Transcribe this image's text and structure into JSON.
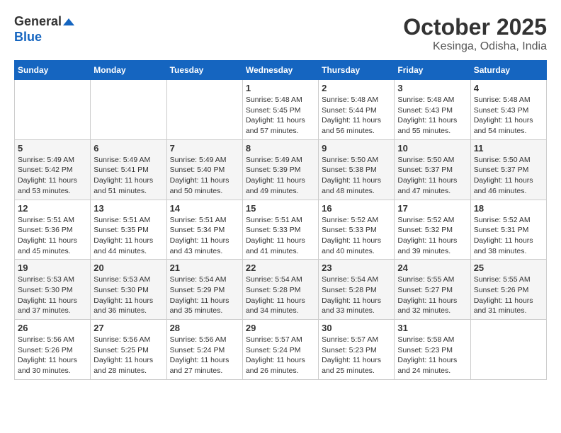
{
  "header": {
    "logo_line1": "General",
    "logo_line2": "Blue",
    "title": "October 2025",
    "subtitle": "Kesinga, Odisha, India"
  },
  "weekdays": [
    "Sunday",
    "Monday",
    "Tuesday",
    "Wednesday",
    "Thursday",
    "Friday",
    "Saturday"
  ],
  "weeks": [
    [
      {
        "day": "",
        "info": ""
      },
      {
        "day": "",
        "info": ""
      },
      {
        "day": "",
        "info": ""
      },
      {
        "day": "1",
        "info": "Sunrise: 5:48 AM\nSunset: 5:45 PM\nDaylight: 11 hours\nand 57 minutes."
      },
      {
        "day": "2",
        "info": "Sunrise: 5:48 AM\nSunset: 5:44 PM\nDaylight: 11 hours\nand 56 minutes."
      },
      {
        "day": "3",
        "info": "Sunrise: 5:48 AM\nSunset: 5:43 PM\nDaylight: 11 hours\nand 55 minutes."
      },
      {
        "day": "4",
        "info": "Sunrise: 5:48 AM\nSunset: 5:43 PM\nDaylight: 11 hours\nand 54 minutes."
      }
    ],
    [
      {
        "day": "5",
        "info": "Sunrise: 5:49 AM\nSunset: 5:42 PM\nDaylight: 11 hours\nand 53 minutes."
      },
      {
        "day": "6",
        "info": "Sunrise: 5:49 AM\nSunset: 5:41 PM\nDaylight: 11 hours\nand 51 minutes."
      },
      {
        "day": "7",
        "info": "Sunrise: 5:49 AM\nSunset: 5:40 PM\nDaylight: 11 hours\nand 50 minutes."
      },
      {
        "day": "8",
        "info": "Sunrise: 5:49 AM\nSunset: 5:39 PM\nDaylight: 11 hours\nand 49 minutes."
      },
      {
        "day": "9",
        "info": "Sunrise: 5:50 AM\nSunset: 5:38 PM\nDaylight: 11 hours\nand 48 minutes."
      },
      {
        "day": "10",
        "info": "Sunrise: 5:50 AM\nSunset: 5:37 PM\nDaylight: 11 hours\nand 47 minutes."
      },
      {
        "day": "11",
        "info": "Sunrise: 5:50 AM\nSunset: 5:37 PM\nDaylight: 11 hours\nand 46 minutes."
      }
    ],
    [
      {
        "day": "12",
        "info": "Sunrise: 5:51 AM\nSunset: 5:36 PM\nDaylight: 11 hours\nand 45 minutes."
      },
      {
        "day": "13",
        "info": "Sunrise: 5:51 AM\nSunset: 5:35 PM\nDaylight: 11 hours\nand 44 minutes."
      },
      {
        "day": "14",
        "info": "Sunrise: 5:51 AM\nSunset: 5:34 PM\nDaylight: 11 hours\nand 43 minutes."
      },
      {
        "day": "15",
        "info": "Sunrise: 5:51 AM\nSunset: 5:33 PM\nDaylight: 11 hours\nand 41 minutes."
      },
      {
        "day": "16",
        "info": "Sunrise: 5:52 AM\nSunset: 5:33 PM\nDaylight: 11 hours\nand 40 minutes."
      },
      {
        "day": "17",
        "info": "Sunrise: 5:52 AM\nSunset: 5:32 PM\nDaylight: 11 hours\nand 39 minutes."
      },
      {
        "day": "18",
        "info": "Sunrise: 5:52 AM\nSunset: 5:31 PM\nDaylight: 11 hours\nand 38 minutes."
      }
    ],
    [
      {
        "day": "19",
        "info": "Sunrise: 5:53 AM\nSunset: 5:30 PM\nDaylight: 11 hours\nand 37 minutes."
      },
      {
        "day": "20",
        "info": "Sunrise: 5:53 AM\nSunset: 5:30 PM\nDaylight: 11 hours\nand 36 minutes."
      },
      {
        "day": "21",
        "info": "Sunrise: 5:54 AM\nSunset: 5:29 PM\nDaylight: 11 hours\nand 35 minutes."
      },
      {
        "day": "22",
        "info": "Sunrise: 5:54 AM\nSunset: 5:28 PM\nDaylight: 11 hours\nand 34 minutes."
      },
      {
        "day": "23",
        "info": "Sunrise: 5:54 AM\nSunset: 5:28 PM\nDaylight: 11 hours\nand 33 minutes."
      },
      {
        "day": "24",
        "info": "Sunrise: 5:55 AM\nSunset: 5:27 PM\nDaylight: 11 hours\nand 32 minutes."
      },
      {
        "day": "25",
        "info": "Sunrise: 5:55 AM\nSunset: 5:26 PM\nDaylight: 11 hours\nand 31 minutes."
      }
    ],
    [
      {
        "day": "26",
        "info": "Sunrise: 5:56 AM\nSunset: 5:26 PM\nDaylight: 11 hours\nand 30 minutes."
      },
      {
        "day": "27",
        "info": "Sunrise: 5:56 AM\nSunset: 5:25 PM\nDaylight: 11 hours\nand 28 minutes."
      },
      {
        "day": "28",
        "info": "Sunrise: 5:56 AM\nSunset: 5:24 PM\nDaylight: 11 hours\nand 27 minutes."
      },
      {
        "day": "29",
        "info": "Sunrise: 5:57 AM\nSunset: 5:24 PM\nDaylight: 11 hours\nand 26 minutes."
      },
      {
        "day": "30",
        "info": "Sunrise: 5:57 AM\nSunset: 5:23 PM\nDaylight: 11 hours\nand 25 minutes."
      },
      {
        "day": "31",
        "info": "Sunrise: 5:58 AM\nSunset: 5:23 PM\nDaylight: 11 hours\nand 24 minutes."
      },
      {
        "day": "",
        "info": ""
      }
    ]
  ]
}
